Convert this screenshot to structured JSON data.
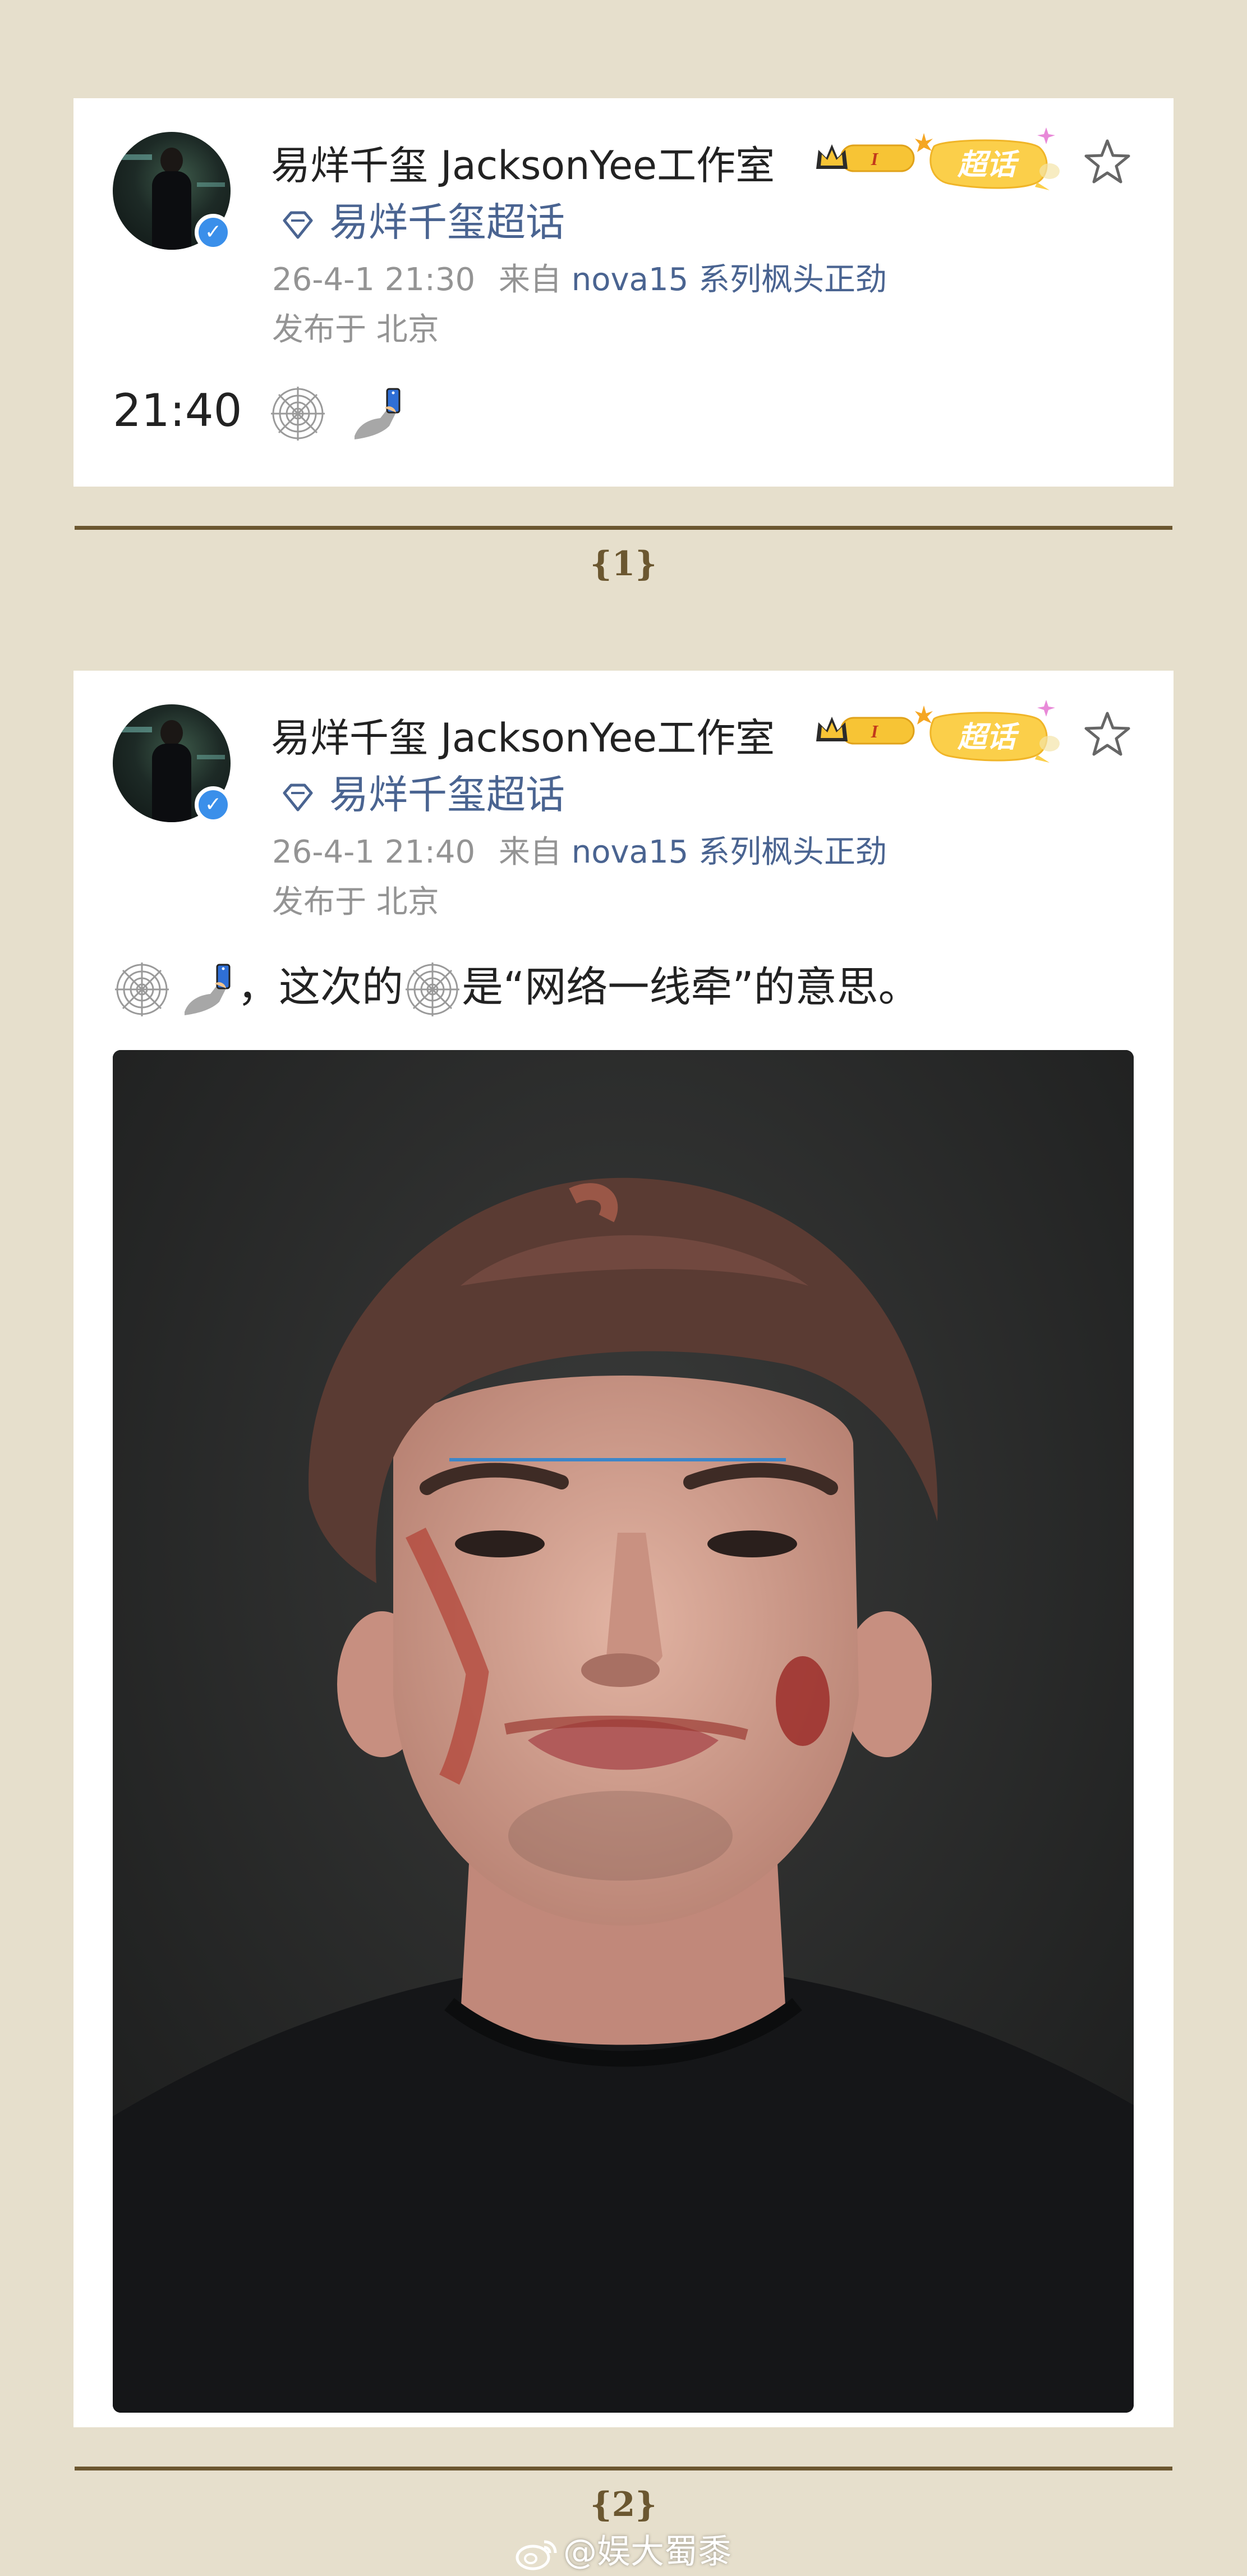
{
  "posts": [
    {
      "author": "易烊千玺 JacksonYee工作室",
      "badge_level": "I",
      "badge_label": "超话",
      "supertopic": "易烊千玺超话",
      "time": "26-4-1 21:30",
      "source_prefix": "来自",
      "device": "nova15 系列枫头正劲",
      "location": "发布于 北京",
      "text": "21:40",
      "caption": "{1}"
    },
    {
      "author": "易烊千玺 JacksonYee工作室",
      "badge_level": "I",
      "badge_label": "超话",
      "supertopic": "易烊千玺超话",
      "time": "26-4-1 21:40",
      "source_prefix": "来自",
      "device": "nova15 系列枫头正劲",
      "location": "发布于 北京",
      "text_part1": "，这次的",
      "text_part2": "是“网络一线牵”的意思。",
      "caption": "{2}"
    }
  ],
  "icons": {
    "web_emoji": "spider-web-icon",
    "selfie_emoji": "selfie-icon",
    "star": "star-icon",
    "verified": "verified-icon",
    "supertopic": "diamond-icon",
    "weibo": "weibo-icon"
  },
  "watermark": "@娱大蜀黍",
  "colors": {
    "background": "#e6dfcc",
    "link": "#4a6491",
    "divider": "#6b5730",
    "verified": "#3a8fea",
    "badge": "#f7c435"
  }
}
